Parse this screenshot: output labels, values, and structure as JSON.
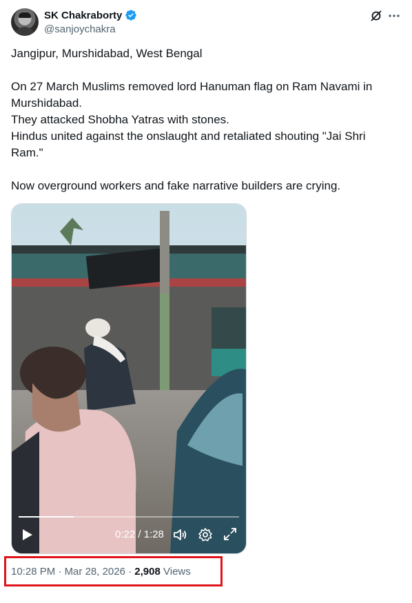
{
  "author": {
    "name": "SK Chakraborty",
    "handle": "@sanjoychakra",
    "verified": true,
    "avatar_icon": "avatar-portrait-icon"
  },
  "header_actions": {
    "grok_icon": "grok-icon",
    "more_icon": "more-options-icon"
  },
  "tweet": {
    "text": "Jangipur, Murshidabad, West Bengal\n\nOn 27 March Muslims removed lord Hanuman flag on Ram Navami in Murshidabad.\nThey attacked Shobha Yatras with stones.\nHindus united against the onslaught and retaliated shouting \"Jai Shri Ram.\"\n\nNow overground workers and fake narrative builders are crying."
  },
  "video": {
    "time_display": "0:22 / 1:28",
    "progress": 0.25,
    "controls": [
      "play-icon",
      "volume-icon",
      "settings-icon",
      "fullscreen-icon"
    ]
  },
  "meta": {
    "time": "10:28 PM",
    "separator": "·",
    "date": "Mar 28, 2026",
    "views_count": "2,908",
    "views_label": "Views"
  },
  "colors": {
    "verified": "#1d9bf0",
    "text_primary": "#0f1419",
    "text_secondary": "#536471",
    "highlight_box": "#e0131a"
  }
}
